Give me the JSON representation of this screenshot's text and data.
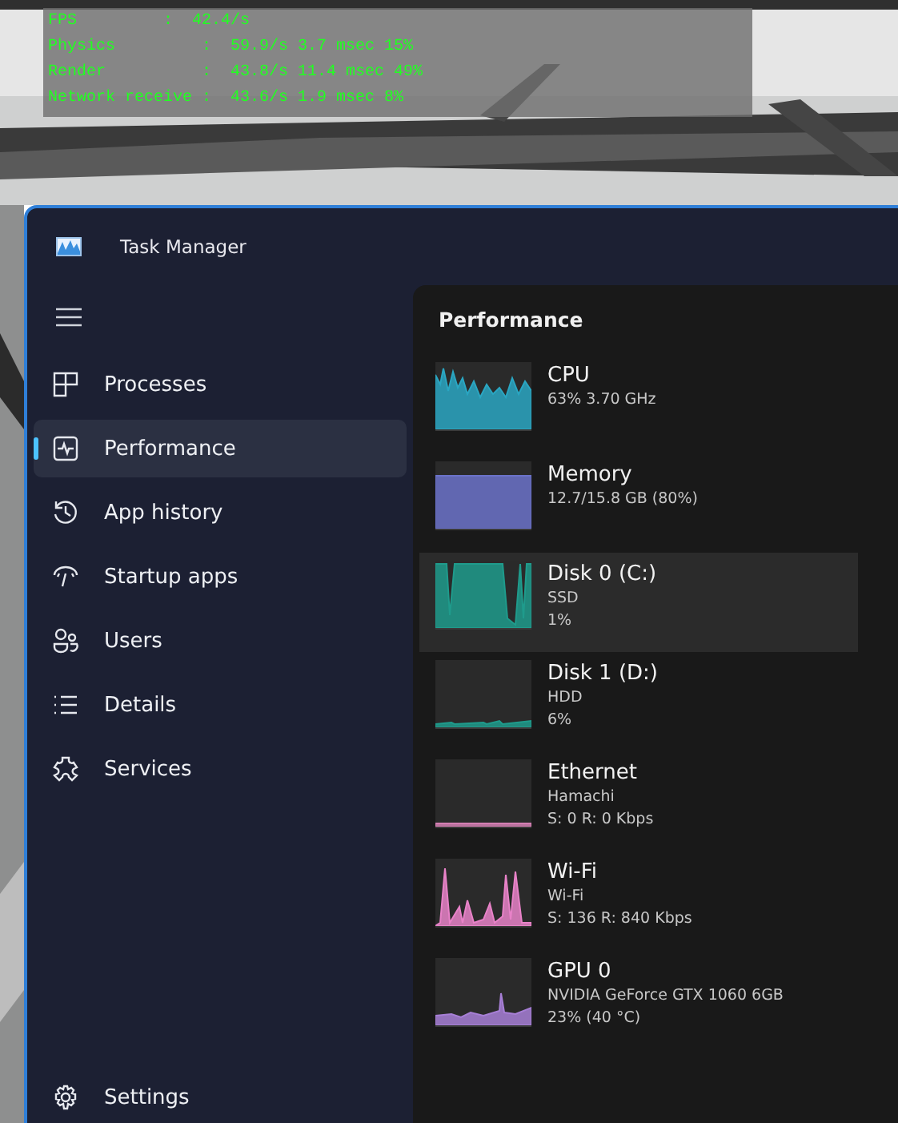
{
  "stats_overlay": {
    "lines": [
      "FPS         :  42.4/s",
      "Physics         :  59.9/s 3.7 msec 15%",
      "Render          :  43.8/s 11.4 msec 49%",
      "Network receive :  43.6/s 1.9 msec 8%"
    ]
  },
  "window": {
    "title": "Task Manager"
  },
  "sidebar": {
    "items": [
      {
        "label": "Processes",
        "selected": false
      },
      {
        "label": "Performance",
        "selected": true
      },
      {
        "label": "App history",
        "selected": false
      },
      {
        "label": "Startup apps",
        "selected": false
      },
      {
        "label": "Users",
        "selected": false
      },
      {
        "label": "Details",
        "selected": false
      },
      {
        "label": "Services",
        "selected": false
      }
    ],
    "settings": {
      "label": "Settings"
    }
  },
  "performance": {
    "title": "Performance",
    "devices": [
      {
        "name": "CPU",
        "details": [
          "63%  3.70 GHz"
        ],
        "color": "#2aa6c2",
        "selected": false
      },
      {
        "name": "Memory",
        "details": [
          "12.7/15.8 GB (80%)"
        ],
        "color": "#6b72c9",
        "selected": false
      },
      {
        "name": "Disk 0 (C:)",
        "details": [
          "SSD",
          "1%"
        ],
        "color": "#1f9b8c",
        "selected": true
      },
      {
        "name": "Disk 1 (D:)",
        "details": [
          "HDD",
          "6%"
        ],
        "color": "#1f9b8c",
        "selected": false
      },
      {
        "name": "Ethernet",
        "details": [
          "Hamachi",
          "S: 0 R: 0 Kbps"
        ],
        "color": "#d47fb3",
        "selected": false
      },
      {
        "name": "Wi-Fi",
        "details": [
          "Wi-Fi",
          "S: 136 R: 840 Kbps"
        ],
        "color": "#e882c8",
        "selected": false
      },
      {
        "name": "GPU 0",
        "details": [
          "NVIDIA GeForce GTX 1060 6GB",
          "23%  (40 °C)"
        ],
        "color": "#a77fd6",
        "selected": false
      }
    ]
  }
}
